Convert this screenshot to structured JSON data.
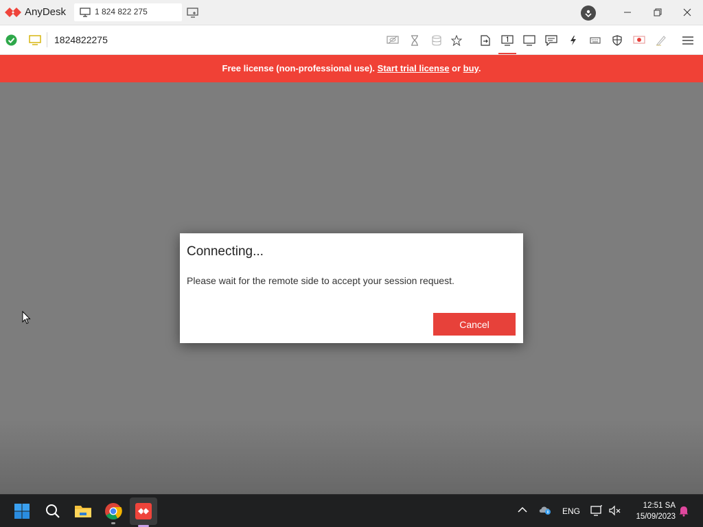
{
  "app": {
    "title": "AnyDesk",
    "tab_label": "1 824 822 275"
  },
  "address": {
    "value": "1824822275"
  },
  "toolbar": {
    "tools": [
      "privacy-mode",
      "session-timer",
      "database",
      "favorite",
      "file-transfer",
      "display-1",
      "monitor",
      "chat",
      "actions",
      "keyboard",
      "permissions",
      "record",
      "whiteboard",
      "menu"
    ],
    "active_tool": "display-1"
  },
  "banner": {
    "prefix": "Free license (non-professional use). ",
    "trial_link": "Start trial license",
    "middle": " or ",
    "buy_link": "buy",
    "suffix": "."
  },
  "dialog": {
    "title": "Connecting...",
    "message": "Please wait for the remote side to accept your session request.",
    "cancel_label": "Cancel"
  },
  "taskbar": {
    "language": "ENG",
    "time": "12:51 SA",
    "date": "15/09/2023"
  },
  "colors": {
    "brand": "#ef443b",
    "banner": "#f04136",
    "remote_bg": "#7d7d7d",
    "taskbar": "#1f2021"
  }
}
